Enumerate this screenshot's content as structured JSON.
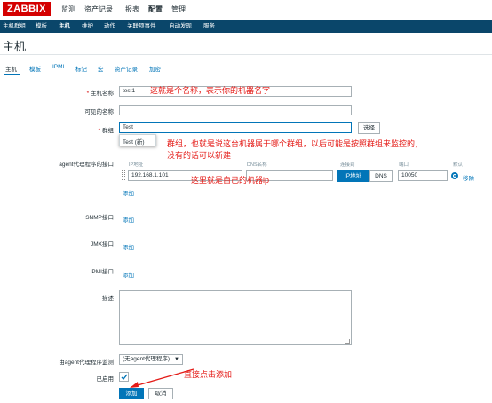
{
  "top_nav": {
    "logo": "ZABBIX",
    "items": [
      "监测",
      "资产记录",
      "报表",
      "配置",
      "管理"
    ]
  },
  "sub_nav": {
    "items": [
      "主机群组",
      "模板",
      "主机",
      "维护",
      "动作",
      "关联项事件",
      "自动发现",
      "服务"
    ]
  },
  "page": {
    "title": "主机"
  },
  "tabs": [
    "主机",
    "模板",
    "IPMI",
    "标记",
    "宏",
    "资产记录",
    "加密"
  ],
  "form": {
    "host_name_label": "主机名称",
    "host_name_value": "test1",
    "visible_name_label": "可见的名称",
    "visible_name_value": "",
    "groups_label": "群组",
    "groups_value": "Test",
    "select_button": "选择",
    "dropdown_option": "Test (新)",
    "agent_label": "agent代理程序的接口",
    "col_ip": "IP地址",
    "col_dns": "DNS名称",
    "col_connect": "连接到",
    "col_port": "端口",
    "col_default": "默认",
    "ip_value": "192.168.1.101",
    "dns_value": "",
    "connect_ip": "IP地址",
    "connect_dns": "DNS",
    "port_value": "10050",
    "remove_link": "移除",
    "add_link": "添加",
    "snmp_label": "SNMP接口",
    "jmx_label": "JMX接口",
    "ipmi_label": "IPMI接口",
    "desc_label": "描述",
    "proxy_label": "由agent代理程序监测",
    "proxy_value": "(无agent代理程序)",
    "enabled_label": "已启用",
    "add_button": "添加",
    "cancel_button": "取消"
  },
  "annotations": {
    "host_name": "这就是个名称，表示你的机器名字",
    "group_line1": "群组，也就是说这台机器属于哪个群组，以后可能是按照群组来监控的,",
    "group_line2": "没有的话可以新建",
    "ip": "这里就是自己的机器ip",
    "add": "直接点击添加"
  },
  "colors": {
    "brand": "#d40000",
    "nav_bg": "#0a466a",
    "primary": "#0275b8",
    "annotation": "#e41b17"
  }
}
